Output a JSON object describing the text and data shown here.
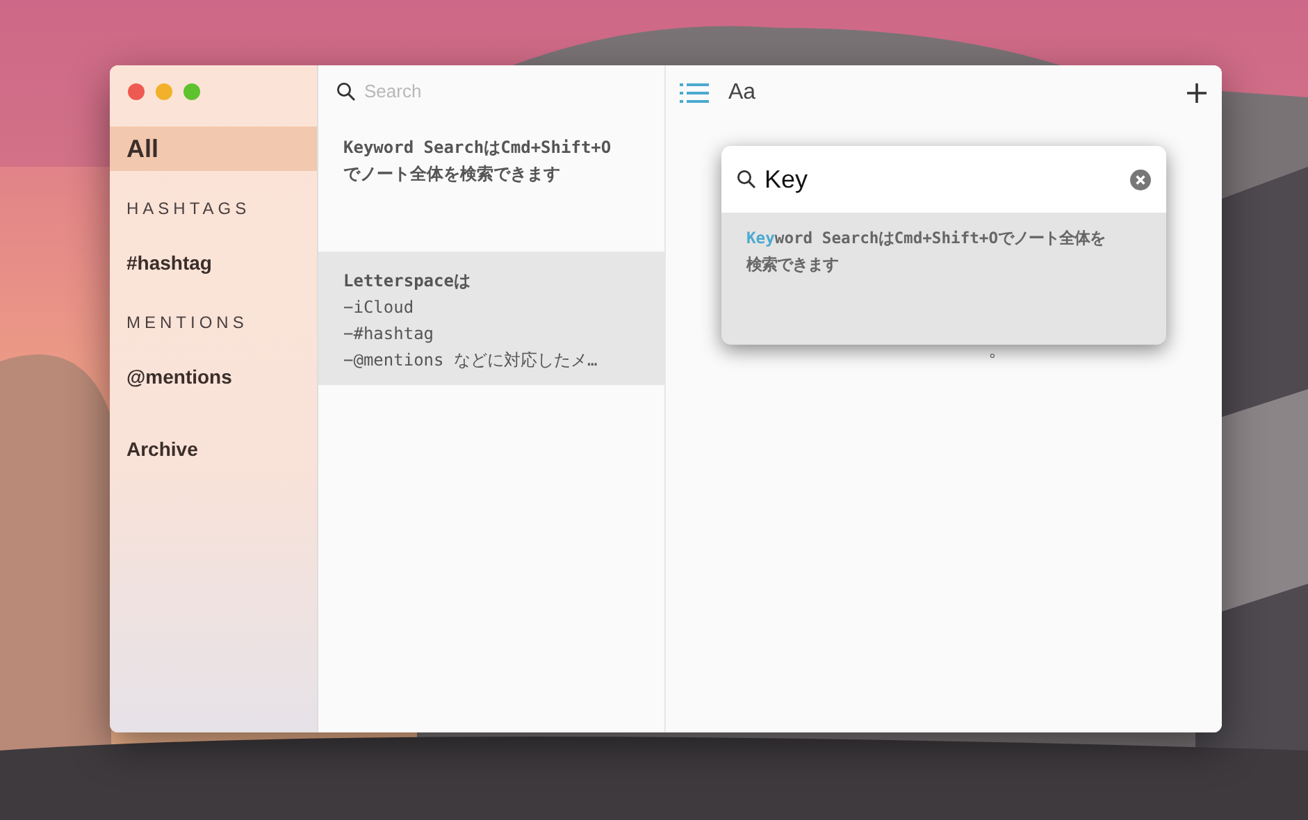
{
  "sidebar": {
    "items": [
      {
        "kind": "item",
        "label": "All",
        "selected": true
      },
      {
        "kind": "heading",
        "label": "HASHTAGS"
      },
      {
        "kind": "item",
        "label": "#hashtag",
        "selected": false
      },
      {
        "kind": "heading",
        "label": "MENTIONS"
      },
      {
        "kind": "item",
        "label": "@mentions",
        "selected": false
      },
      {
        "kind": "gap"
      },
      {
        "kind": "item",
        "label": "Archive",
        "selected": false
      }
    ]
  },
  "notes": {
    "search": {
      "placeholder": "Search"
    },
    "items": [
      {
        "title": [
          "Keyword SearchはCmd+Shift+O",
          "でノート全体を検索できます"
        ],
        "selected": false
      },
      {
        "title": [
          "Letterspaceは"
        ],
        "body": [
          "−iCloud",
          "−#hashtag",
          "−@mentions などに対応したメ…"
        ],
        "selected": true
      }
    ]
  },
  "editor": {
    "toolbar": {
      "font_button": "Aa"
    },
    "visible_text": "。"
  },
  "search_popup": {
    "query": "Key",
    "results": [
      {
        "match": "Key",
        "rest": "word SearchはCmd+Shift+Oでノート全体を検索できます"
      }
    ]
  }
}
